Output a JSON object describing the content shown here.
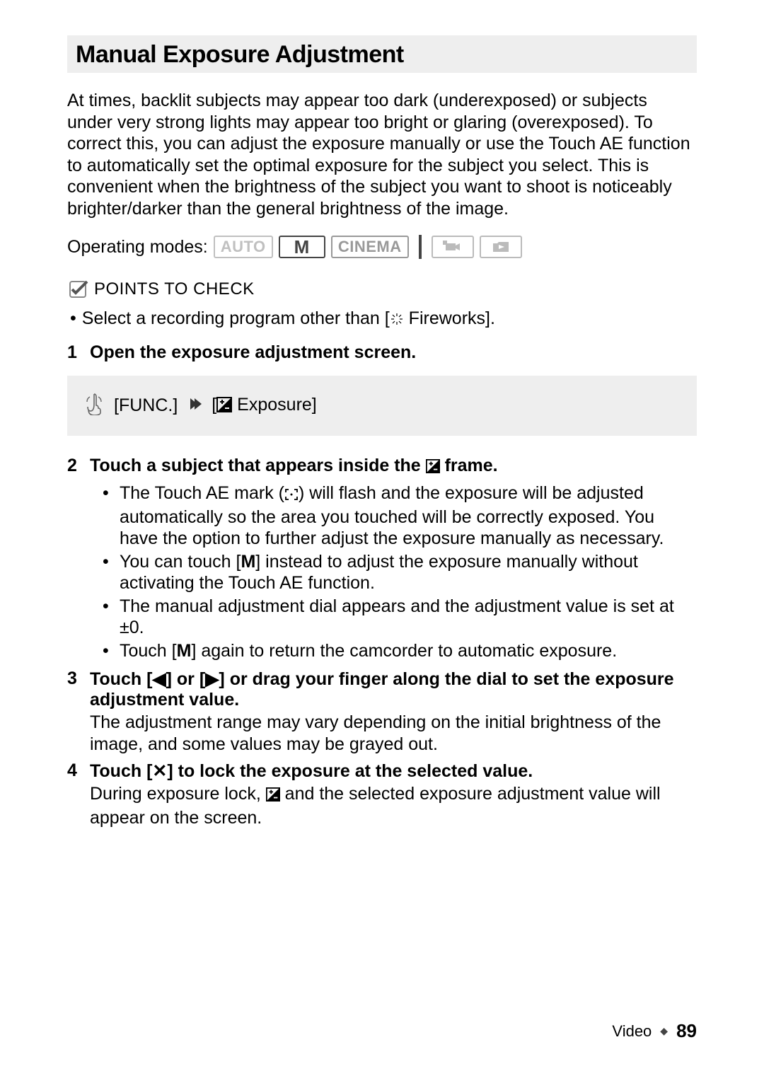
{
  "title": "Manual Exposure Adjustment",
  "intro": "At times, backlit subjects may appear too dark (underexposed) or subjects under very strong lights may appear too bright or glaring (overexposed). To correct this, you can adjust the exposure manually or use the Touch AE function to automatically set the optimal exposure for the subject you select. This is convenient when the brightness of the subject you want to shoot is noticeably brighter/darker than the general brightness of the image.",
  "modes": {
    "label": "Operating modes:",
    "auto": "AUTO",
    "m": "M",
    "cinema": "CINEMA"
  },
  "points_label": "POINTS TO CHECK",
  "points_bullet_pre": "Select a recording program other than [",
  "points_bullet_post": " Fireworks].",
  "steps": {
    "s1": {
      "num": "1",
      "title": "Open the exposure adjustment screen.",
      "callout_func": "[FUNC.]",
      "callout_exposure": "  Exposure]"
    },
    "s2": {
      "num": "2",
      "title_pre": "Touch a subject that appears inside the ",
      "title_post": " frame.",
      "b1_pre": "The Touch AE mark (",
      "b1_post": ") will flash and the exposure will be adjusted automatically so the area you touched will be correctly exposed. You have the option to further adjust the exposure manually as necessary.",
      "b2_pre": "You can touch [",
      "b2_mid": "M",
      "b2_post": "] instead to adjust the exposure manually without activating the Touch AE function.",
      "b3": "The manual adjustment dial appears and the adjustment value is set at ±0.",
      "b4_pre": "Touch [",
      "b4_mid": "M",
      "b4_post": "] again to return the camcorder to automatic exposure."
    },
    "s3": {
      "num": "3",
      "title_pre": "Touch [",
      "title_mid1": "◀",
      "title_mid2": "] or [",
      "title_mid3": "▶",
      "title_post": "] or drag your finger along the dial to set the exposure adjustment value.",
      "desc": "The adjustment range may vary depending on the initial brightness of the image, and some values may be grayed out."
    },
    "s4": {
      "num": "4",
      "title_pre": "Touch [",
      "title_mid": "✕",
      "title_post": "] to lock the exposure at the selected value.",
      "desc_pre": "During exposure lock, ",
      "desc_post": " and the selected exposure adjustment value will appear on the screen."
    }
  },
  "footer": {
    "section": "Video",
    "page": "89"
  }
}
